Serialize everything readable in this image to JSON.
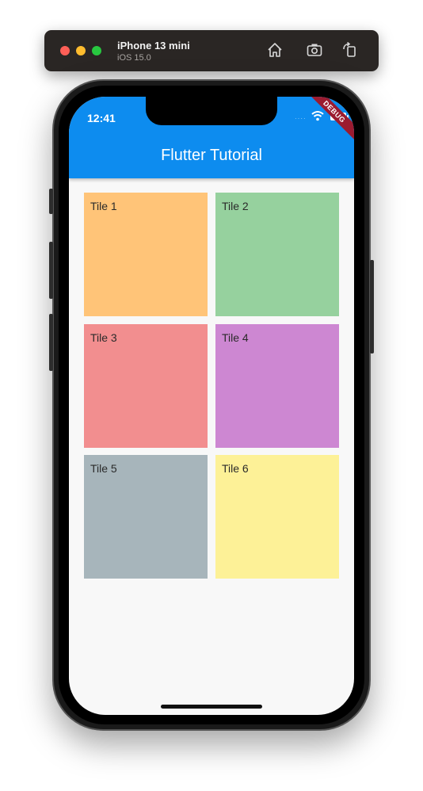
{
  "simulator": {
    "device_name": "iPhone 13 mini",
    "os_version": "iOS 15.0",
    "icons": [
      "home-icon",
      "screenshot-icon",
      "rotate-icon"
    ]
  },
  "status_bar": {
    "time": "12:41"
  },
  "debug_banner": "DEBUG",
  "app_bar": {
    "title": "Flutter Tutorial",
    "color": "#0d8cef"
  },
  "tiles": [
    {
      "label": "Tile 1",
      "color": "#ffc478"
    },
    {
      "label": "Tile 2",
      "color": "#96d19e"
    },
    {
      "label": "Tile 3",
      "color": "#f28e8f"
    },
    {
      "label": "Tile 4",
      "color": "#cd87d2"
    },
    {
      "label": "Tile 5",
      "color": "#a7b5bb"
    },
    {
      "label": "Tile 6",
      "color": "#fdf197"
    }
  ]
}
